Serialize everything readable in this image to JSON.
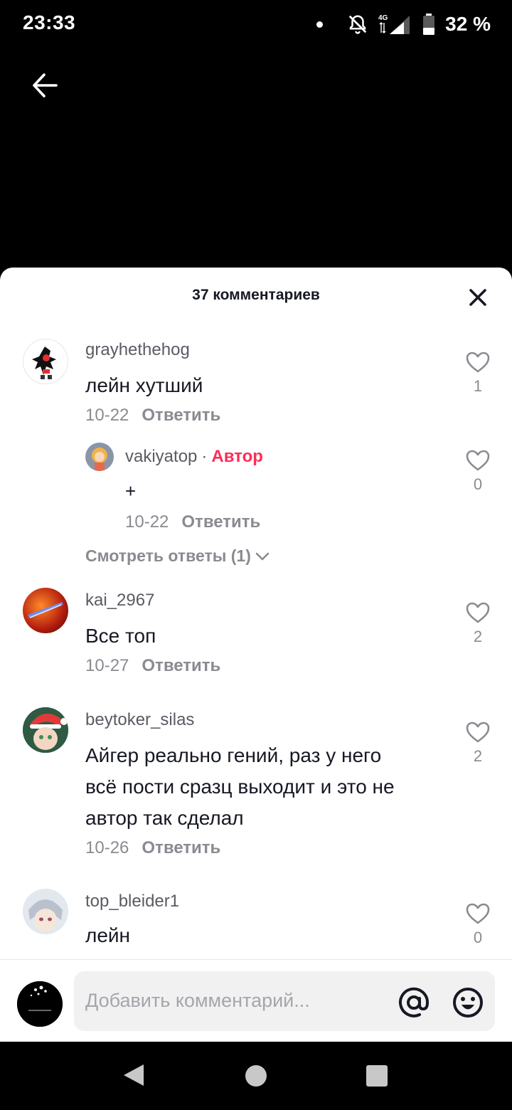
{
  "status_bar": {
    "time": "23:33",
    "network": "4G",
    "battery": "32 %",
    "icons": [
      "notification-dot-icon",
      "bell-muted-icon",
      "signal-icon",
      "battery-icon"
    ]
  },
  "sheet": {
    "title": "37 комментариев"
  },
  "comments": [
    {
      "username": "grayhethehog",
      "text": "лейн хутший",
      "date": "10-22",
      "reply_label": "Ответить",
      "likes": "1",
      "reply": {
        "username": "vakiyatop",
        "author_badge": "Автор",
        "text": "+",
        "date": "10-22",
        "reply_label": "Ответить",
        "likes": "0"
      },
      "view_replies": "Смотреть ответы (1)"
    },
    {
      "username": "kai_2967",
      "text": "Все топ",
      "date": "10-27",
      "reply_label": "Ответить",
      "likes": "2"
    },
    {
      "username": "beytoker_silas",
      "text_lines": [
        "Айгер реально гений, раз у него",
        "всё пости сразц выходит и это не",
        "автор так сделал"
      ],
      "date": "10-26",
      "reply_label": "Ответить",
      "likes": "2"
    },
    {
      "username": "top_bleider1",
      "text": "лейн",
      "likes": "0"
    }
  ],
  "input": {
    "placeholder": "Добавить комментарий..."
  },
  "colors": {
    "author_badge": "#fe2c55",
    "username": "#5a5b63",
    "meta": "#8a8b91",
    "text": "#161823"
  }
}
